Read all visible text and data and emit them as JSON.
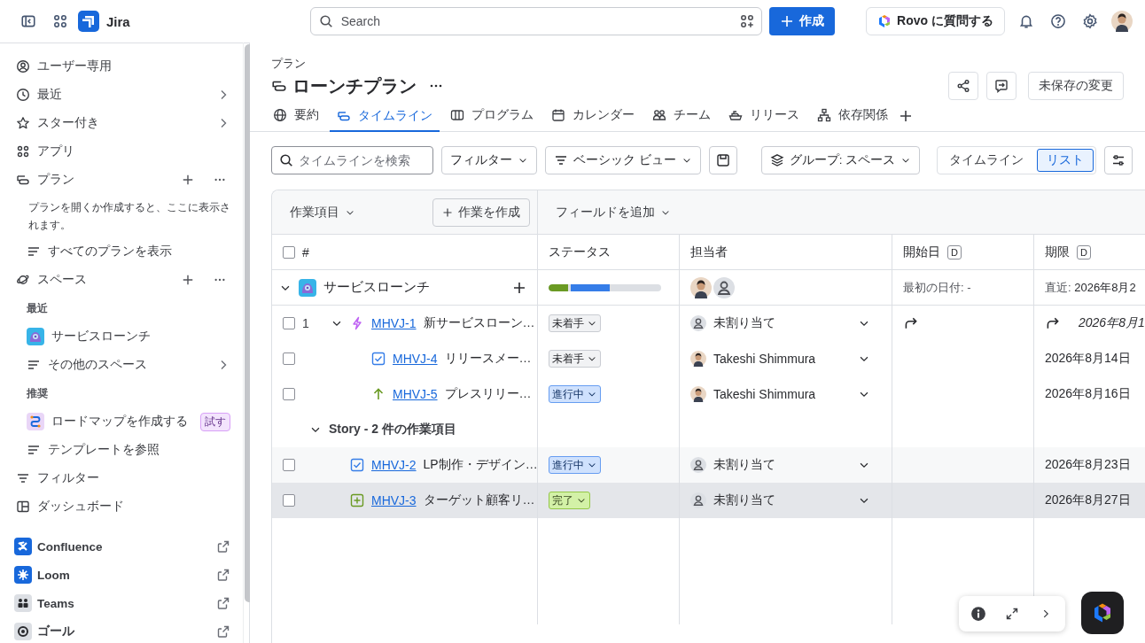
{
  "topbar": {
    "app_name": "Jira",
    "search_placeholder": "Search",
    "create_label": "作成",
    "rovo_label": "Rovo に質問する"
  },
  "sidebar": {
    "items": [
      {
        "kind": "link",
        "label": "ユーザー専用"
      },
      {
        "kind": "menu",
        "label": "最近"
      },
      {
        "kind": "menu",
        "label": "スター付き"
      },
      {
        "kind": "link",
        "label": "アプリ"
      },
      {
        "kind": "section",
        "label": "プラン"
      },
      {
        "kind": "note",
        "label": "プランを開くか作成すると、ここに表示されます。"
      },
      {
        "kind": "sublink",
        "label": "すべてのプランを表示"
      },
      {
        "kind": "section",
        "label": "スペース"
      },
      {
        "kind": "heading",
        "label": "最近"
      },
      {
        "kind": "sublink",
        "label": "サービスローンチ"
      },
      {
        "kind": "submenu",
        "label": "その他のスペース"
      },
      {
        "kind": "heading",
        "label": "推奨"
      },
      {
        "kind": "suggest",
        "label": "ロードマップを作成する",
        "badge": "試す"
      },
      {
        "kind": "sublink",
        "label": "テンプレートを参照"
      },
      {
        "kind": "link",
        "label": "フィルター"
      },
      {
        "kind": "link",
        "label": "ダッシュボード"
      },
      {
        "kind": "app",
        "label": "Confluence"
      },
      {
        "kind": "app",
        "label": "Loom"
      },
      {
        "kind": "app",
        "label": "Teams"
      },
      {
        "kind": "app",
        "label": "ゴール"
      }
    ]
  },
  "header": {
    "breadcrumb": "プラン",
    "title": "ローンチプラン",
    "unsaved_label": "未保存の変更"
  },
  "tabs": [
    {
      "label": "要約",
      "selected": false
    },
    {
      "label": "タイムライン",
      "selected": true
    },
    {
      "label": "プログラム",
      "selected": false
    },
    {
      "label": "カレンダー",
      "selected": false
    },
    {
      "label": "チーム",
      "selected": false
    },
    {
      "label": "リリース",
      "selected": false
    },
    {
      "label": "依存関係",
      "selected": false
    }
  ],
  "toolbar": {
    "search_placeholder": "タイムラインを検索",
    "filter_label": "フィルター",
    "view_label": "ベーシック ビュー",
    "group_label": "グループ: スペース",
    "views": [
      {
        "label": "タイムライン",
        "selected": false
      },
      {
        "label": "リスト",
        "selected": true
      }
    ]
  },
  "table": {
    "items_label": "作業項目",
    "create_label": "作業を作成",
    "add_field_label": "フィールドを追加",
    "all_checked": false,
    "columns": [
      {
        "label": "#"
      },
      {
        "label": "ステータス"
      },
      {
        "label": "担当者"
      },
      {
        "label": "開始日",
        "badge": "D"
      },
      {
        "label": "期限",
        "badge": "D"
      }
    ],
    "space_row": {
      "name": "サービスローンチ",
      "expanded": true,
      "progress": [
        {
          "level": 0.2,
          "color": "#6a9a23"
        },
        {
          "level": 0.37,
          "color": "#357de8"
        }
      ],
      "start": "最初の日付: -",
      "due_label": "直近:",
      "due": "2026年8月2"
    },
    "rows": [
      {
        "kind": "epic",
        "number": "1",
        "key": "MHVJ-1",
        "summary": "新サービスローン…",
        "status": {
          "kind": "todo",
          "label": "未着手"
        },
        "assignee": {
          "kind": "none",
          "name": "未割り当て"
        },
        "rolled_up": true,
        "due": "2026年8月1",
        "expanded": true,
        "checked": false,
        "selected": false,
        "children": [
          {
            "kind": "task",
            "key": "MHVJ-4",
            "summary": "リリースメー…",
            "status": {
              "kind": "todo",
              "label": "未着手"
            },
            "assignee": {
              "kind": "photo",
              "name": "Takeshi Shimmura"
            },
            "rolled_up": false,
            "due": "2026年8月14日",
            "checked": false,
            "selected": false
          },
          {
            "kind": "improvement",
            "key": "MHVJ-5",
            "summary": "プレスリリー…",
            "status": {
              "kind": "progress",
              "label": "進行中"
            },
            "assignee": {
              "kind": "photo",
              "name": "Takeshi Shimmura"
            },
            "rolled_up": false,
            "due": "2026年8月16日",
            "checked": false,
            "selected": false
          }
        ]
      },
      {
        "kind": "group",
        "label": "Story - 2 件の作業項目",
        "expanded": true,
        "children": [
          {
            "kind": "task",
            "key": "MHVJ-2",
            "summary": "LP制作・デザイン…",
            "status": {
              "kind": "progress",
              "label": "進行中"
            },
            "assignee": {
              "kind": "none",
              "name": "未割り当て"
            },
            "rolled_up": false,
            "due": "2026年8月23日",
            "checked": false,
            "selected": false
          },
          {
            "kind": "new",
            "key": "MHVJ-3",
            "summary": "ターゲット顧客リ…",
            "status": {
              "kind": "done",
              "label": "完了"
            },
            "assignee": {
              "kind": "none",
              "name": "未割り当て"
            },
            "rolled_up": false,
            "due": "2026年8月27日",
            "checked": false,
            "selected": true
          }
        ]
      }
    ]
  }
}
